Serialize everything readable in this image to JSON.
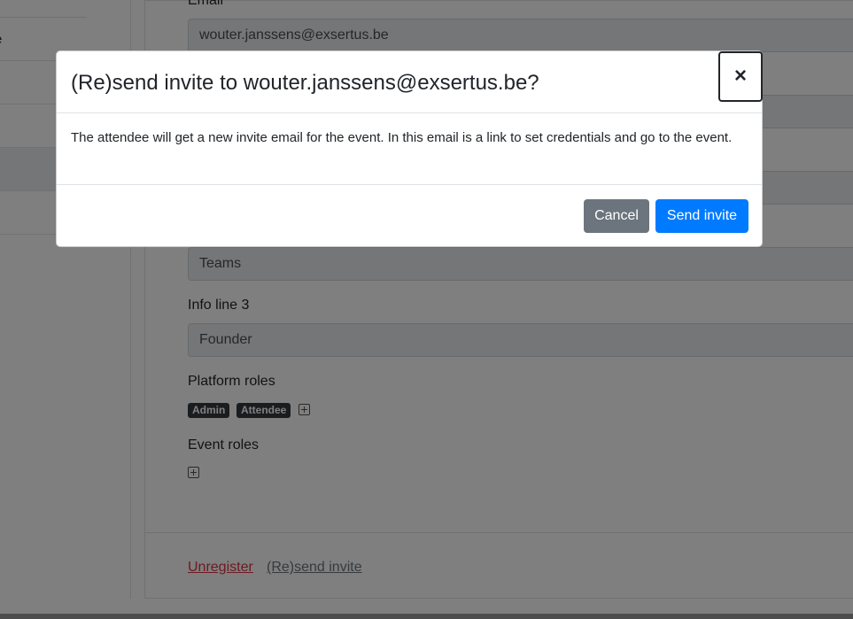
{
  "sidebar": {
    "items": [
      {
        "label": "e",
        "active": false
      },
      {
        "label": "",
        "active": false
      },
      {
        "label": "",
        "active": false
      },
      {
        "label": "",
        "active": true
      },
      {
        "label": "",
        "active": false
      }
    ]
  },
  "form": {
    "email_label": "Email",
    "email_value": "wouter.janssens@exsertus.be",
    "info2_value": "Teams",
    "info3_label": "Info line 3",
    "info3_value": "Founder",
    "platform_roles_label": "Platform roles",
    "platform_roles": [
      "Admin",
      "Attendee"
    ],
    "event_roles_label": "Event roles"
  },
  "footer": {
    "unregister": "Unregister",
    "resend": "(Re)send invite"
  },
  "modal": {
    "title": "(Re)send invite to wouter.janssens@exsertus.be?",
    "close_glyph": "×",
    "body": "The attendee will get a new invite email for the event. In this email is a link to set credentials and go to the event.",
    "cancel_label": "Cancel",
    "send_label": "Send invite"
  }
}
